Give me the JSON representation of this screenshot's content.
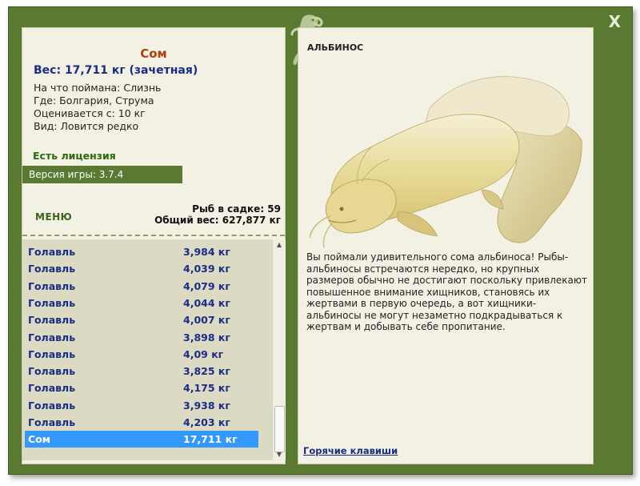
{
  "window": {
    "close_label": "X"
  },
  "catch": {
    "name": "Сом",
    "weight": "Вес: 17,711 кг (зачетная)",
    "caught_with": "На что поймана: Слизнь",
    "location": "Где: Болгария, Струма",
    "valued_from": "Оценивается с: 10 кг",
    "rarity": "Вид: Ловится редко"
  },
  "license": "Есть лицензия",
  "version": "Версия игры: 3.7.4",
  "menu_label": "МЕНЮ",
  "stats": {
    "fish_count": "Рыб в садке: 59",
    "total_weight": "Общий вес: 627,877 кг"
  },
  "catch_list": [
    {
      "name": "Голавль",
      "weight": "3,984 кг"
    },
    {
      "name": "Голавль",
      "weight": "4,039 кг"
    },
    {
      "name": "Голавль",
      "weight": "4,079 кг"
    },
    {
      "name": "Голавль",
      "weight": "4,044 кг"
    },
    {
      "name": "Голавль",
      "weight": "4,007 кг"
    },
    {
      "name": "Голавль",
      "weight": "3,898 кг"
    },
    {
      "name": "Голавль",
      "weight": "4,09 кг"
    },
    {
      "name": "Голавль",
      "weight": "3,825 кг"
    },
    {
      "name": "Голавль",
      "weight": "4,175 кг"
    },
    {
      "name": "Голавль",
      "weight": "3,938 кг"
    },
    {
      "name": "Голавль",
      "weight": "4,203 кг"
    },
    {
      "name": "Сом",
      "weight": "17,711 кг",
      "selected": true
    }
  ],
  "albino": {
    "title": "АЛЬБИНОС",
    "description": "Вы поймали удивительного сома альбиноса! Рыбы-альбиносы встречаются нередко, но крупных размеров обычно не достигают поскольку привлекают повышенное внимание хищников, становясь их жертвами в первую очередь, а вот хищники-альбиносы не могут незаметно подкрадываться к жертвам и добывать себе пропитание."
  },
  "hotkeys_label": "Горячие клавиши",
  "colors": {
    "frame": "#5a7a32",
    "panel": "#f2f1e4",
    "list_bg": "#dcdac2",
    "selection": "#3399ff",
    "fish_name": "#b0400e",
    "text_blue": "#1a2d86",
    "license_green": "#2c6a0e"
  }
}
